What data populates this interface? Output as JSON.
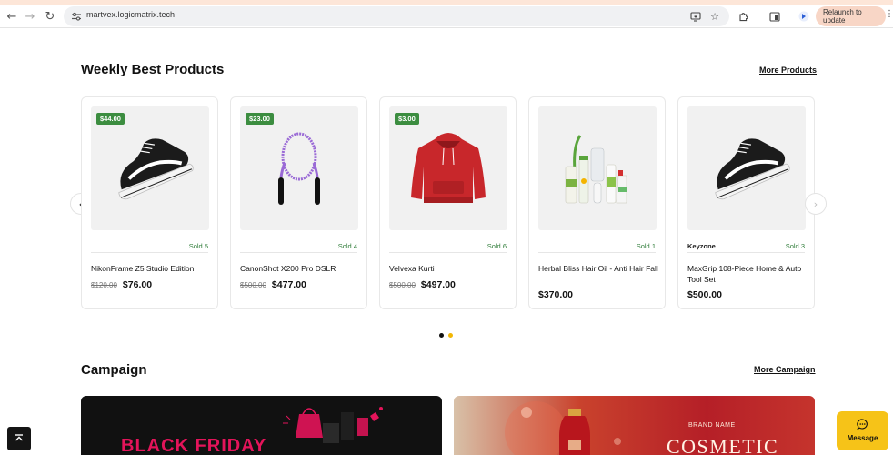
{
  "browser": {
    "url": "martvex.logicmatrix.tech",
    "relaunch_label": "Relaunch to update",
    "icons": [
      "back-icon",
      "forward-icon",
      "reload-icon",
      "site-info-icon",
      "install-icon",
      "bookmark-star-icon",
      "extensions-icon",
      "split-view-icon",
      "profile-icon",
      "more-menu-icon"
    ]
  },
  "weekly": {
    "title": "Weekly Best Products",
    "more_link": "More Products",
    "products": [
      {
        "badge": "$44.00",
        "brand": "",
        "sold": "Sold 5",
        "name": "NikonFrame Z5 Studio Edition",
        "old_price": "$120.00",
        "price": "$76.00",
        "image": "sneaker"
      },
      {
        "badge": "$23.00",
        "brand": "",
        "sold": "Sold 4",
        "name": "CanonShot X200 Pro DSLR",
        "old_price": "$500.00",
        "price": "$477.00",
        "image": "jump-rope"
      },
      {
        "badge": "$3.00",
        "brand": "",
        "sold": "Sold 6",
        "name": "Velvexa Kurti",
        "old_price": "$500.00",
        "price": "$497.00",
        "image": "hoodie"
      },
      {
        "badge": "",
        "brand": "",
        "sold": "Sold 1",
        "name": "Herbal Bliss Hair Oil - Anti Hair Fall",
        "old_price": "",
        "price": "$370.00",
        "image": "cosmetics"
      },
      {
        "badge": "",
        "brand": "Keyzone",
        "sold": "Sold 3",
        "name": "MaxGrip 108-Piece Home & Auto Tool Set",
        "old_price": "",
        "price": "$500.00",
        "image": "sneaker"
      }
    ],
    "carousel_dots": [
      "inactive",
      "active"
    ]
  },
  "campaign": {
    "title": "Campaign",
    "more_link": "More Campaign",
    "banners": [
      {
        "text": "BLACK FRIDAY"
      },
      {
        "brand_label": "BRAND NAME",
        "text": "COSMETIC"
      }
    ]
  },
  "floating": {
    "message_label": "Message"
  },
  "colors": {
    "badge_green": "#3c8d40",
    "sold_green": "#2f7d39",
    "message_yellow": "#f6c318",
    "active_dot": "#f2b705",
    "black_friday_pink": "#e4145a"
  }
}
